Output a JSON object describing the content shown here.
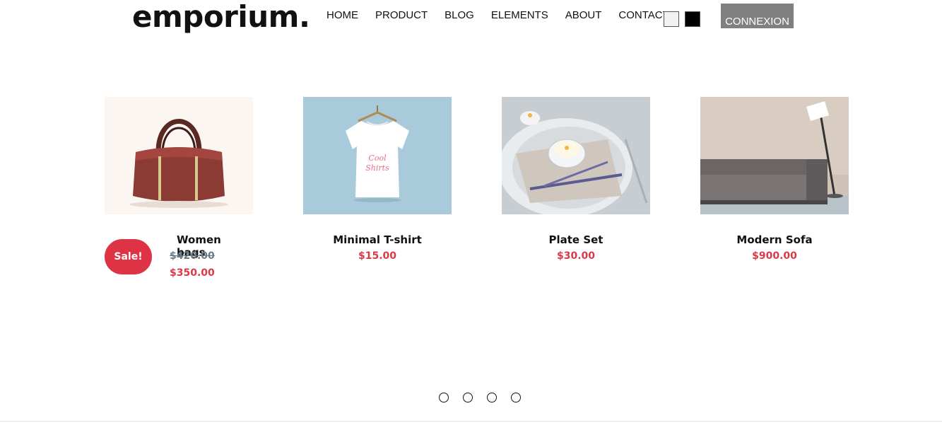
{
  "brand": {
    "logo": "emporium."
  },
  "nav": {
    "items": [
      "HOME",
      "PRODUCT",
      "BLOG",
      "ELEMENTS",
      "ABOUT",
      "CONTACT"
    ]
  },
  "theme_swatches": [
    {
      "name": "light",
      "color": "#f2f2f2"
    },
    {
      "name": "dark",
      "color": "#000000"
    }
  ],
  "auth": {
    "connexion_label": "CONNEXION"
  },
  "products": [
    {
      "name": "Women bags",
      "old_price": "$420.00",
      "price": "$350.00",
      "badge": "Sale!"
    },
    {
      "name": "Minimal T-shirt",
      "price": "$15.00"
    },
    {
      "name": "Plate Set",
      "price": "$30.00"
    },
    {
      "name": "Modern Sofa",
      "price": "$900.00"
    }
  ],
  "carousel": {
    "dot_count": 4
  },
  "colors": {
    "accent": "#d93a4a",
    "button": "#808080"
  }
}
